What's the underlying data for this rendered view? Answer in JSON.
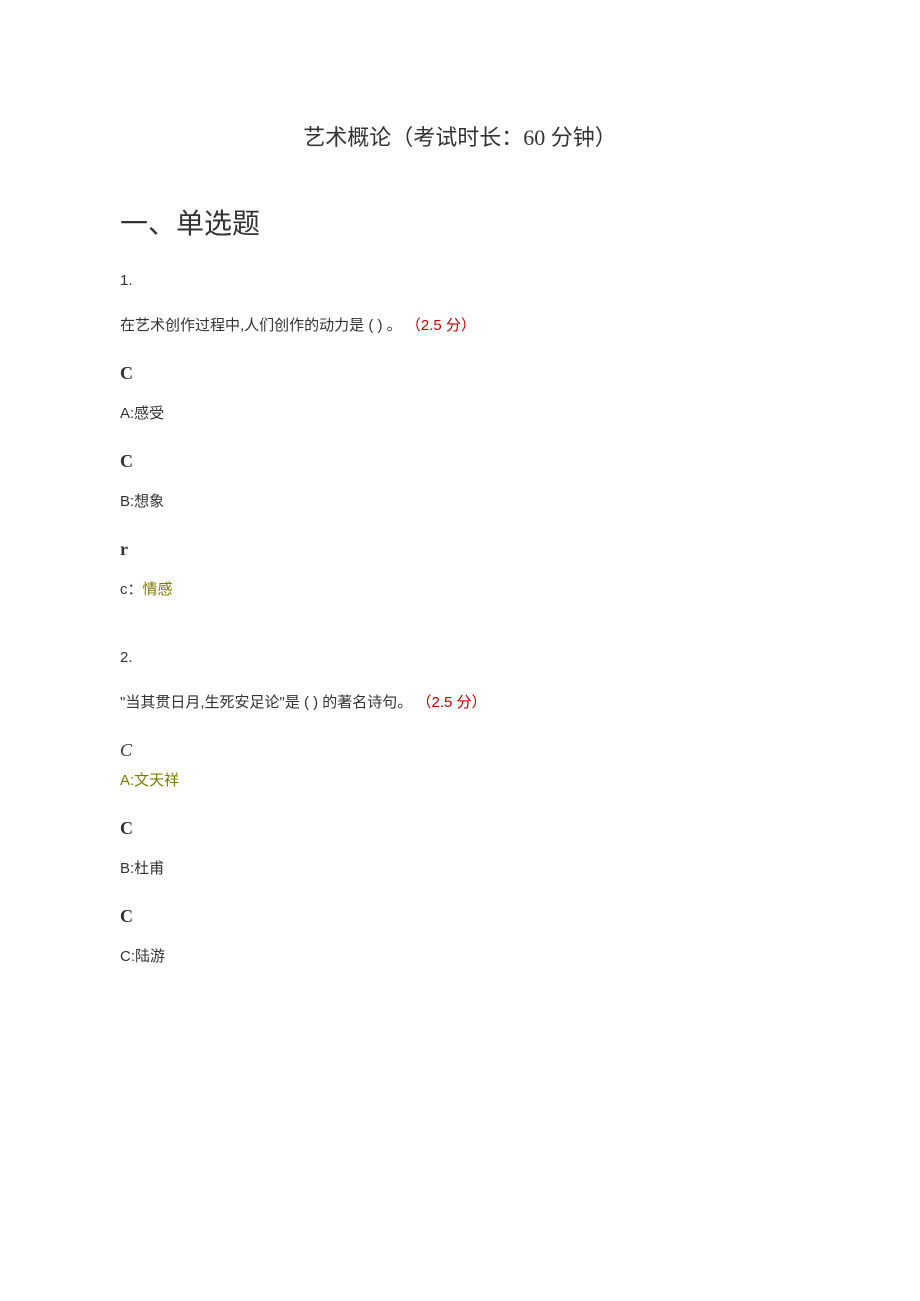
{
  "title": "艺术概论（考试时长：60 分钟）",
  "section_heading": "一、单选题",
  "q1": {
    "num": "1.",
    "stem": "在艺术创作过程中,人们创作的动力是 ( ) 。",
    "points": "（2.5 分）",
    "mark_a": "C",
    "opt_a": "A:感受",
    "mark_b": "C",
    "opt_b": "B:想象",
    "mark_c": "r",
    "opt_c_label": "c：",
    "opt_c_ans": "情感"
  },
  "q2": {
    "num": "2.",
    "stem": "\"当其贯日月,生死安足论\"是 ( ) 的著名诗句。",
    "points": "（2.5 分）",
    "mark_a": "C",
    "opt_a": "A:文天祥",
    "mark_b": "C",
    "opt_b": "B:杜甫",
    "mark_c": "C",
    "opt_c": "C:陆游"
  }
}
